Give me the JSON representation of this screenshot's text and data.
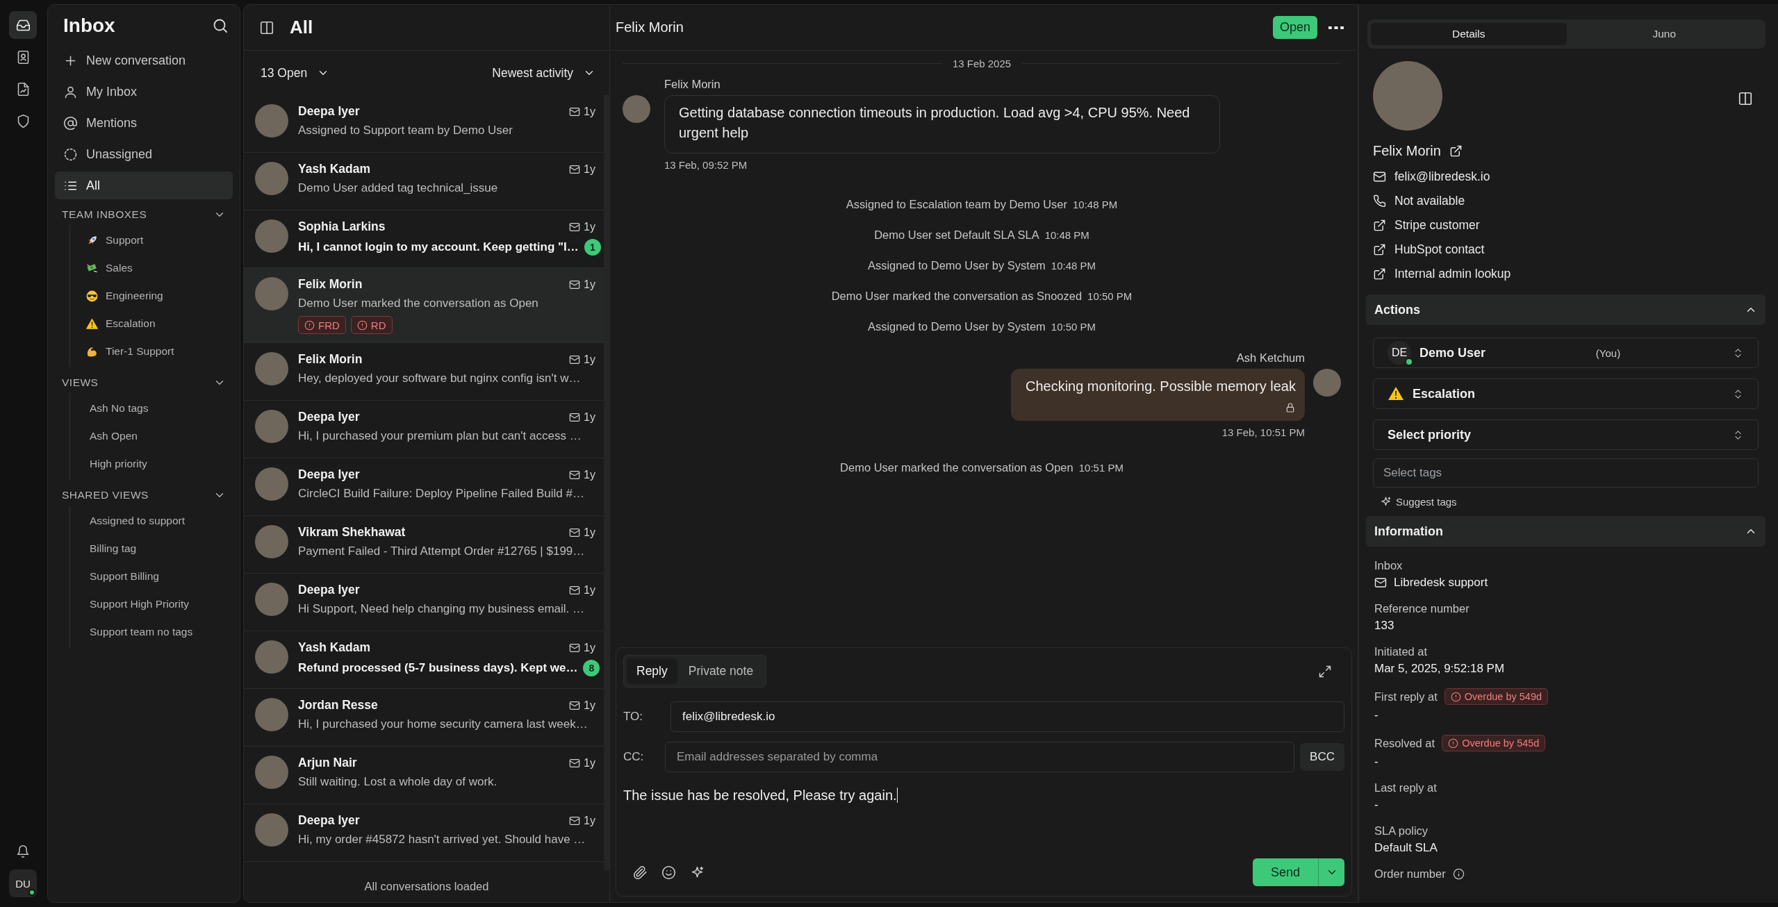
{
  "rail": {
    "items": [
      {
        "selected": true
      },
      {
        "selected": false
      },
      {
        "selected": false
      },
      {
        "selected": false
      }
    ],
    "user_initials": "DU",
    "user_online": true
  },
  "sidebar": {
    "title": "Inbox",
    "items": [
      {
        "label": "New conversation",
        "selected": false
      },
      {
        "label": "My Inbox",
        "selected": false
      },
      {
        "label": "Mentions",
        "selected": false
      },
      {
        "label": "Unassigned",
        "selected": false
      },
      {
        "label": "All",
        "selected": true
      }
    ],
    "sections": [
      {
        "title": "TEAM INBOXES",
        "expanded": true,
        "items": [
          {
            "label": "Support"
          },
          {
            "label": "Sales"
          },
          {
            "label": "Engineering"
          },
          {
            "label": "Escalation"
          },
          {
            "label": "Tier-1 Support"
          }
        ]
      },
      {
        "title": "VIEWS",
        "expanded": true,
        "items": [
          {
            "label": "Ash No tags"
          },
          {
            "label": "Ash Open"
          },
          {
            "label": "High priority"
          }
        ]
      },
      {
        "title": "SHARED VIEWS",
        "expanded": true,
        "items": [
          {
            "label": "Assigned to support"
          },
          {
            "label": "Billing tag"
          },
          {
            "label": "Support Billing"
          },
          {
            "label": "Support High Priority"
          },
          {
            "label": "Support team no tags"
          }
        ]
      }
    ]
  },
  "list": {
    "title": "All",
    "status_filter": "13 Open",
    "sort": "Newest activity",
    "footer": "All conversations loaded",
    "conversations": [
      {
        "name": "Deepa Iyer",
        "time": "1y",
        "preview": "Assigned to Support team by Demo User",
        "unread": false,
        "selected": false
      },
      {
        "name": "Yash Kadam",
        "time": "1y",
        "preview": "Demo User added tag technical_issue",
        "unread": false,
        "selected": false
      },
      {
        "name": "Sophia Larkins",
        "time": "1y",
        "preview": "Hi, I cannot login to my account. Keep getting \"I…",
        "unread": true,
        "unread_count": "1",
        "selected": false
      },
      {
        "name": "Felix Morin",
        "time": "1y",
        "preview": "Demo User marked the conversation as Open",
        "unread": false,
        "selected": true,
        "tags": [
          "FRD",
          "RD"
        ]
      },
      {
        "name": "Felix Morin",
        "time": "1y",
        "preview": "Hey, deployed your software but nginx config isn't w…",
        "unread": false,
        "selected": false
      },
      {
        "name": "Deepa Iyer",
        "time": "1y",
        "preview": "Hi, I purchased your premium plan but can't access …",
        "unread": false,
        "selected": false
      },
      {
        "name": "Deepa Iyer",
        "time": "1y",
        "preview": "CircleCI Build Failure: Deploy Pipeline Failed Build #…",
        "unread": false,
        "selected": false
      },
      {
        "name": "Vikram Shekhawat",
        "time": "1y",
        "preview": "Payment Failed - Third Attempt Order #12765 | $199…",
        "unread": false,
        "selected": false
      },
      {
        "name": "Deepa Iyer",
        "time": "1y",
        "preview": "Hi Support, Need help changing my business email. …",
        "unread": false,
        "selected": false
      },
      {
        "name": "Yash Kadam",
        "time": "1y",
        "preview": "Refund processed (5-7 business days). Kept we…",
        "unread": true,
        "unread_count": "8",
        "selected": false
      },
      {
        "name": "Jordan Resse",
        "time": "1y",
        "preview": "Hi, I purchased your home security camera last week…",
        "unread": false,
        "selected": false
      },
      {
        "name": "Arjun Nair",
        "time": "1y",
        "preview": "Still waiting. Lost a whole day of work.",
        "unread": false,
        "selected": false
      },
      {
        "name": "Deepa Iyer",
        "time": "1y",
        "preview": "Hi, my order #45872 hasn't arrived yet. Should have …",
        "unread": false,
        "selected": false
      }
    ]
  },
  "chat": {
    "contact": "Felix Morin",
    "status": "Open",
    "date": "13 Feb 2025",
    "messages": [
      {
        "kind": "incoming",
        "author": "Felix Morin",
        "text": "Getting database connection timeouts in production. Load avg >4, CPU 95%. Need urgent help",
        "time": "13 Feb, 09:52 PM"
      },
      {
        "kind": "event",
        "text": "Assigned to Escalation team by Demo User",
        "time": "10:48 PM"
      },
      {
        "kind": "event",
        "text": "Demo User set Default SLA SLA",
        "time": "10:48 PM"
      },
      {
        "kind": "event",
        "text": "Assigned to Demo User by System",
        "time": "10:48 PM"
      },
      {
        "kind": "event",
        "text": "Demo User marked the conversation as Snoozed",
        "time": "10:50 PM"
      },
      {
        "kind": "event",
        "text": "Assigned to Demo User by System",
        "time": "10:50 PM"
      },
      {
        "kind": "outgoing",
        "author": "Ash Ketchum",
        "text": "Checking monitoring. Possible memory leak",
        "time": "13 Feb, 10:51 PM",
        "private": true
      },
      {
        "kind": "event",
        "text": "Demo User marked the conversation as Open",
        "time": "10:51 PM"
      }
    ],
    "composer": {
      "tabs": [
        {
          "label": "Reply",
          "selected": true
        },
        {
          "label": "Private note",
          "selected": false
        }
      ],
      "to_label": "TO:",
      "to": "felix@libredesk.io",
      "cc_label": "CC:",
      "cc_placeholder": "Email addresses separated by comma",
      "bcc": "BCC",
      "body": "The issue has be resolved, Please try again.",
      "send": "Send"
    }
  },
  "details": {
    "tabs": [
      {
        "label": "Details",
        "selected": true
      },
      {
        "label": "Juno",
        "selected": false
      }
    ],
    "contact": {
      "name": "Felix Morin",
      "fields": [
        {
          "kind": "email",
          "text": "felix@libredesk.io"
        },
        {
          "kind": "phone",
          "text": "Not available"
        },
        {
          "kind": "link",
          "text": "Stripe customer"
        },
        {
          "kind": "link",
          "text": "HubSpot contact"
        },
        {
          "kind": "link",
          "text": "Internal admin lookup"
        }
      ]
    },
    "actions": {
      "title": "Actions",
      "expanded": true,
      "assignee": {
        "initials": "DE",
        "name": "Demo User",
        "note": "(You)",
        "online": true
      },
      "team": {
        "label": "Escalation"
      },
      "priority": "Select priority",
      "tags_placeholder": "Select tags",
      "suggest": "Suggest tags"
    },
    "information": {
      "title": "Information",
      "expanded": true,
      "fields": [
        {
          "label": "Inbox",
          "value": "Libredesk support"
        },
        {
          "label": "Reference number",
          "value": "133"
        },
        {
          "label": "Initiated at",
          "value": "Mar 5, 2025, 9:52:18 PM"
        },
        {
          "label": "First reply at",
          "value": "-",
          "overdue": "Overdue by 549d"
        },
        {
          "label": "Resolved at",
          "value": "-",
          "overdue": "Overdue by 545d"
        },
        {
          "label": "Last reply at",
          "value": "-"
        },
        {
          "label": "SLA policy",
          "value": "Default SLA"
        },
        {
          "label": "Order number"
        }
      ]
    }
  }
}
